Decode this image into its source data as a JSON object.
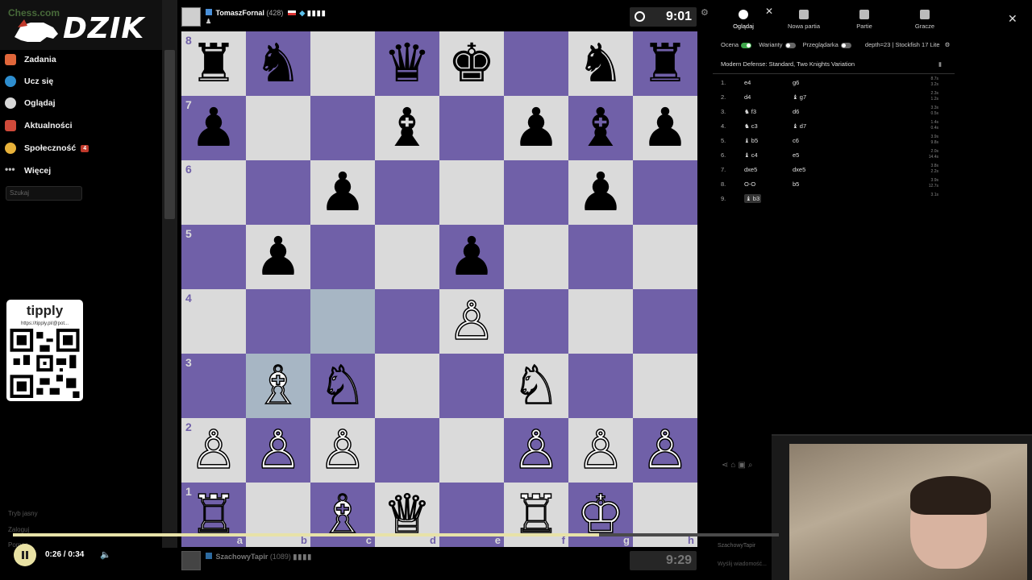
{
  "sidebar": {
    "brand": "DZIK",
    "site": "Chess.com",
    "items": [
      {
        "label": "Zadania",
        "icon": "puzzle-icon",
        "color": "#e0663a"
      },
      {
        "label": "Ucz się",
        "icon": "learn-icon",
        "color": "#2e8ecf"
      },
      {
        "label": "Oglądaj",
        "icon": "watch-icon",
        "color": "#d8d8d8"
      },
      {
        "label": "Aktualności",
        "icon": "news-icon",
        "color": "#d04a3a"
      },
      {
        "label": "Społeczność",
        "icon": "community-icon",
        "color": "#e8b23a",
        "badge": "4"
      },
      {
        "label": "Więcej",
        "icon": "more-icon",
        "color": "#bbbbbb"
      }
    ],
    "search_placeholder": "Szukaj",
    "tipply": {
      "title": "tipply",
      "url": "https://tipply.pl/@pot..."
    },
    "bottom_links": [
      "Tryb jasny",
      "Zaloguj",
      "Pomoc"
    ]
  },
  "top_player": {
    "name": "TomaszFornal",
    "rating": "(428)",
    "clock": "9:01"
  },
  "bottom_player": {
    "name": "SzachowyTapir",
    "rating": "(1089)",
    "clock": "9:29"
  },
  "board": {
    "rows": [
      [
        "♜",
        "♞",
        "",
        "♛",
        "♚",
        "",
        "♞",
        "♜"
      ],
      [
        "♟",
        "",
        "",
        "♝",
        "",
        "♟",
        "♝",
        "♟"
      ],
      [
        "",
        "",
        "♟",
        "",
        "",
        "",
        "♟",
        ""
      ],
      [
        "",
        "♟",
        "",
        "",
        "♟",
        "",
        "",
        ""
      ],
      [
        "",
        "",
        "",
        "",
        "♙",
        "",
        "",
        ""
      ],
      [
        "",
        "♗",
        "♘",
        "",
        "",
        "♘",
        "",
        ""
      ],
      [
        "♙",
        "♙",
        "♙",
        "",
        "",
        "♙",
        "♙",
        "♙"
      ],
      [
        "♖",
        "",
        "♗",
        "♕",
        "",
        "♖",
        "♔",
        ""
      ]
    ],
    "white_pieces": [
      "♙",
      "♘",
      "♗",
      "♖",
      "♕",
      "♔"
    ],
    "ranks": [
      "8",
      "7",
      "6",
      "5",
      "4",
      "3",
      "2",
      "1"
    ],
    "files": [
      "a",
      "b",
      "c",
      "d",
      "e",
      "f",
      "g",
      "h"
    ],
    "highlight": [
      [
        4,
        2
      ],
      [
        5,
        1
      ]
    ]
  },
  "panel": {
    "tabs": [
      {
        "label": "Oglądaj",
        "icon": "watch-tab-icon"
      },
      {
        "label": "Nowa partia",
        "icon": "new-game-icon"
      },
      {
        "label": "Partie",
        "icon": "games-icon"
      },
      {
        "label": "Gracze",
        "icon": "players-icon"
      }
    ],
    "toggles": {
      "eval": "Ocena",
      "variants": "Warianty",
      "browser": "Przeglądarka",
      "engine": "depth=23 | Stockfish 17 Lite"
    },
    "opening": "Modern Defense: Standard, Two Knights Variation",
    "moves": [
      {
        "n": "1.",
        "w": "e4",
        "b": "g6",
        "t": "8.7s\n3.2s"
      },
      {
        "n": "2.",
        "w": "d4",
        "b": "♝ g7",
        "t": "2.3s\n1.2s"
      },
      {
        "n": "3.",
        "w": "♞ f3",
        "b": "d6",
        "t": "3.3s\n0.5s"
      },
      {
        "n": "4.",
        "w": "♞ c3",
        "b": "♝ d7",
        "t": "1.4s\n0.4s"
      },
      {
        "n": "5.",
        "w": "♝ b5",
        "b": "c6",
        "t": "3.9s\n9.8s"
      },
      {
        "n": "6.",
        "w": "♝ c4",
        "b": "e5",
        "t": "2.0s\n14.4s"
      },
      {
        "n": "7.",
        "w": "dxe5",
        "b": "dxe5",
        "t": "3.8s\n2.2s"
      },
      {
        "n": "8.",
        "w": "O-O",
        "b": "b5",
        "t": "3.9s\n12.7s"
      },
      {
        "n": "9.",
        "w": "♝ b3",
        "b": "",
        "t": "3.1s"
      }
    ]
  },
  "under_webcam": {
    "name": "SzachowyTapir",
    "message": "Wyślij wiadomość..."
  },
  "player": {
    "time": "0:26 / 0:34",
    "progress": 0.765
  }
}
